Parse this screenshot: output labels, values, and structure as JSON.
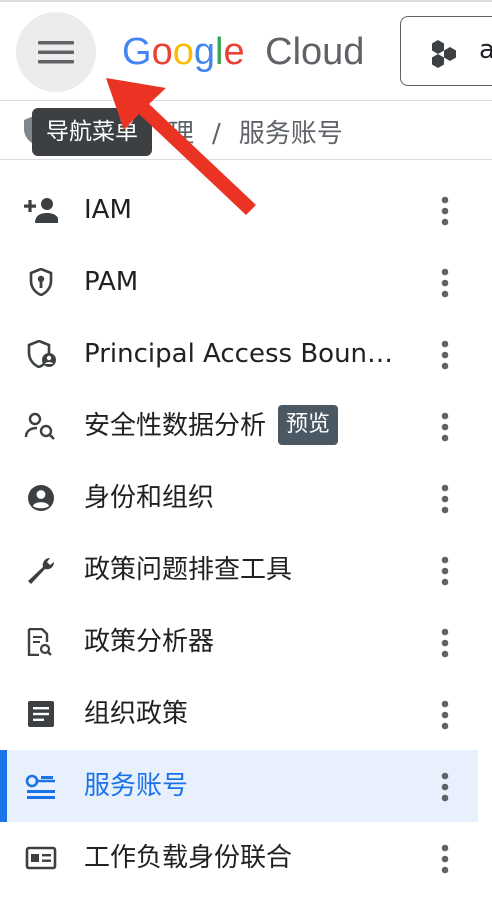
{
  "header": {
    "logo_google_letters": [
      "G",
      "o",
      "o",
      "g",
      "l",
      "e"
    ],
    "logo_google_colors": [
      "#4285F4",
      "#EA4335",
      "#FBBC05",
      "#4285F4",
      "#34A853",
      "#EA4335"
    ],
    "logo_product": "Cloud",
    "project_initial": "a",
    "menu_tooltip": "导航菜单"
  },
  "breadcrumb": {
    "parent": "理",
    "separator": "/",
    "current": "服务账号"
  },
  "nav": {
    "items": [
      {
        "label": "IAM",
        "icon": "person-add-icon"
      },
      {
        "label": "PAM",
        "icon": "shield-key-icon"
      },
      {
        "label": "Principal Access Boun…",
        "icon": "shield-person-icon"
      },
      {
        "label": "安全性数据分析",
        "icon": "person-search-icon",
        "badge": "预览"
      },
      {
        "label": "身份和组织",
        "icon": "account-circle-icon"
      },
      {
        "label": "政策问题排查工具",
        "icon": "wrench-icon"
      },
      {
        "label": "政策分析器",
        "icon": "policy-doc-icon"
      },
      {
        "label": "组织政策",
        "icon": "article-icon"
      },
      {
        "label": "服务账号",
        "icon": "service-account-icon",
        "active": true
      },
      {
        "label": "工作负载身份联合",
        "icon": "id-card-icon"
      }
    ]
  },
  "colors": {
    "accent": "#1a73e8",
    "active_bg": "#e8f0fe",
    "arrow": "#ea3323"
  }
}
